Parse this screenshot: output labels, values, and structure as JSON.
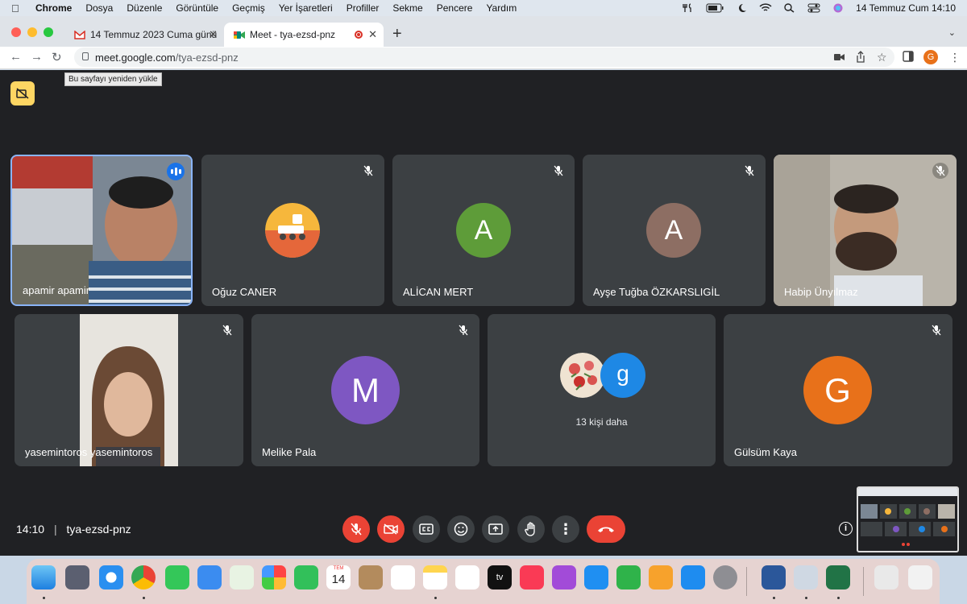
{
  "menubar": {
    "app": "Chrome",
    "items": [
      "Dosya",
      "Düzenle",
      "Görüntüle",
      "Geçmiş",
      "Yer İşaretleri",
      "Profiller",
      "Sekme",
      "Pencere",
      "Yardım"
    ],
    "datetime": "14 Temmuz Cum  14:10"
  },
  "tabs": [
    {
      "title": "14 Temmuz 2023 Cuma günü s",
      "icon": "gmail-icon"
    },
    {
      "title": "Meet - tya-ezsd-pnz",
      "icon": "meet-icon"
    }
  ],
  "address": {
    "host": "meet.google.com",
    "path": "/tya-ezsd-pnz"
  },
  "profile_initial": "G",
  "tooltip": "Bu sayfayı yeniden yükle",
  "participants_row1": [
    {
      "name": "apamir apamir",
      "speaking": true,
      "type": "video"
    },
    {
      "name": "Oğuz CANER",
      "type": "avatar-image"
    },
    {
      "name": "ALİCAN MERT",
      "initial": "A",
      "color": "#5e9c39"
    },
    {
      "name": "Ayşe Tuğba ÖZKARSLIGİL",
      "initial": "A",
      "color": "#8d6e63"
    },
    {
      "name": "Habip Ünyılmaz",
      "type": "video"
    }
  ],
  "participants_row2": [
    {
      "name": "yasemintoros yasemintoros",
      "type": "video"
    },
    {
      "name": "Melike Pala",
      "initial": "M",
      "color": "#7e57c2"
    },
    {
      "more_label": "13 kişi daha",
      "initial": "g",
      "color": "#1e88e5"
    },
    {
      "name": "Gülsüm Kaya",
      "initial": "G",
      "color": "#e8711a"
    }
  ],
  "bottom": {
    "time": "14:10",
    "separator": "|",
    "meeting_code": "tya-ezsd-pnz"
  },
  "calendar_dock": {
    "month": "TEM",
    "day": "14"
  },
  "dock_apple_tv": "tv"
}
